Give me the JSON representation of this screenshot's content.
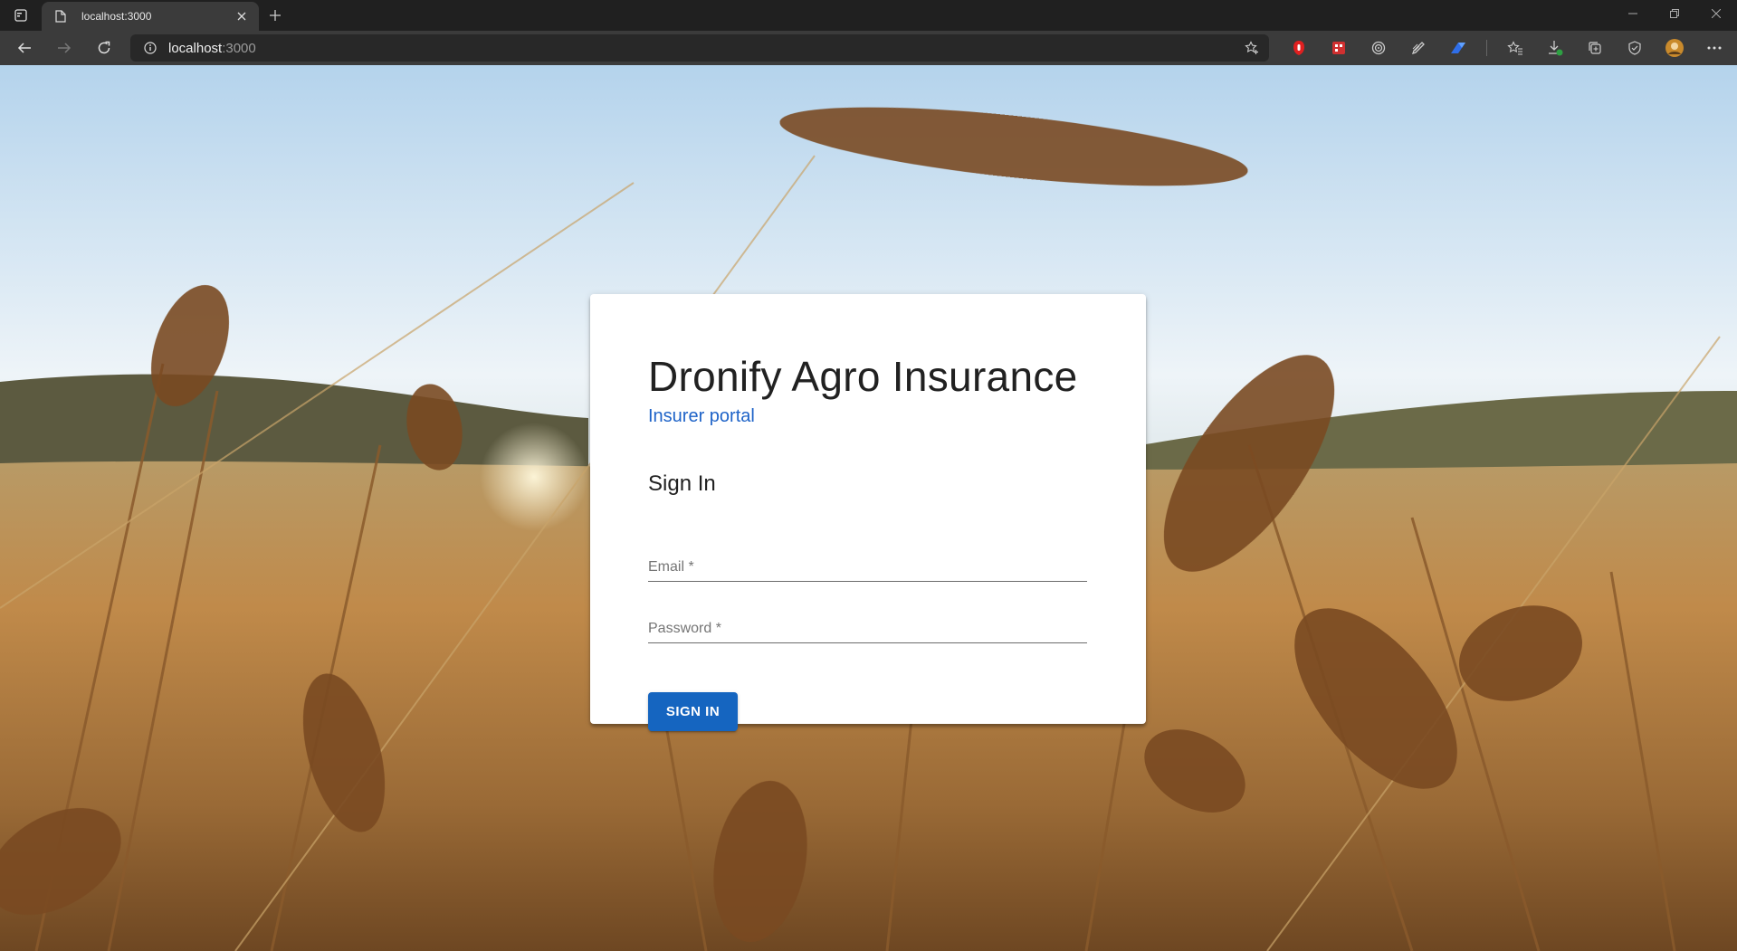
{
  "browser": {
    "tab": {
      "title": "localhost:3000",
      "favicon": "page-icon"
    },
    "address": {
      "host": "localhost",
      "port": ":3000"
    },
    "extensions": [
      "red-shield-icon",
      "red-grid-icon",
      "target-icon",
      "pen-icon",
      "blue-arrow-icon"
    ],
    "toolbar_icons": [
      "favorites-icon",
      "download-icon",
      "collections-icon",
      "performance-icon",
      "profile-avatar",
      "more-icon"
    ]
  },
  "page": {
    "app_title": "Dronify Agro Insurance",
    "app_subtitle": "Insurer portal",
    "signin_heading": "Sign In",
    "email_label": "Email *",
    "email_value": "",
    "password_label": "Password *",
    "password_value": "",
    "signin_button": "SIGN IN",
    "accent_color": "#1565c0",
    "subtitle_color": "#1e63c8",
    "background": "wheat-field-photo"
  }
}
